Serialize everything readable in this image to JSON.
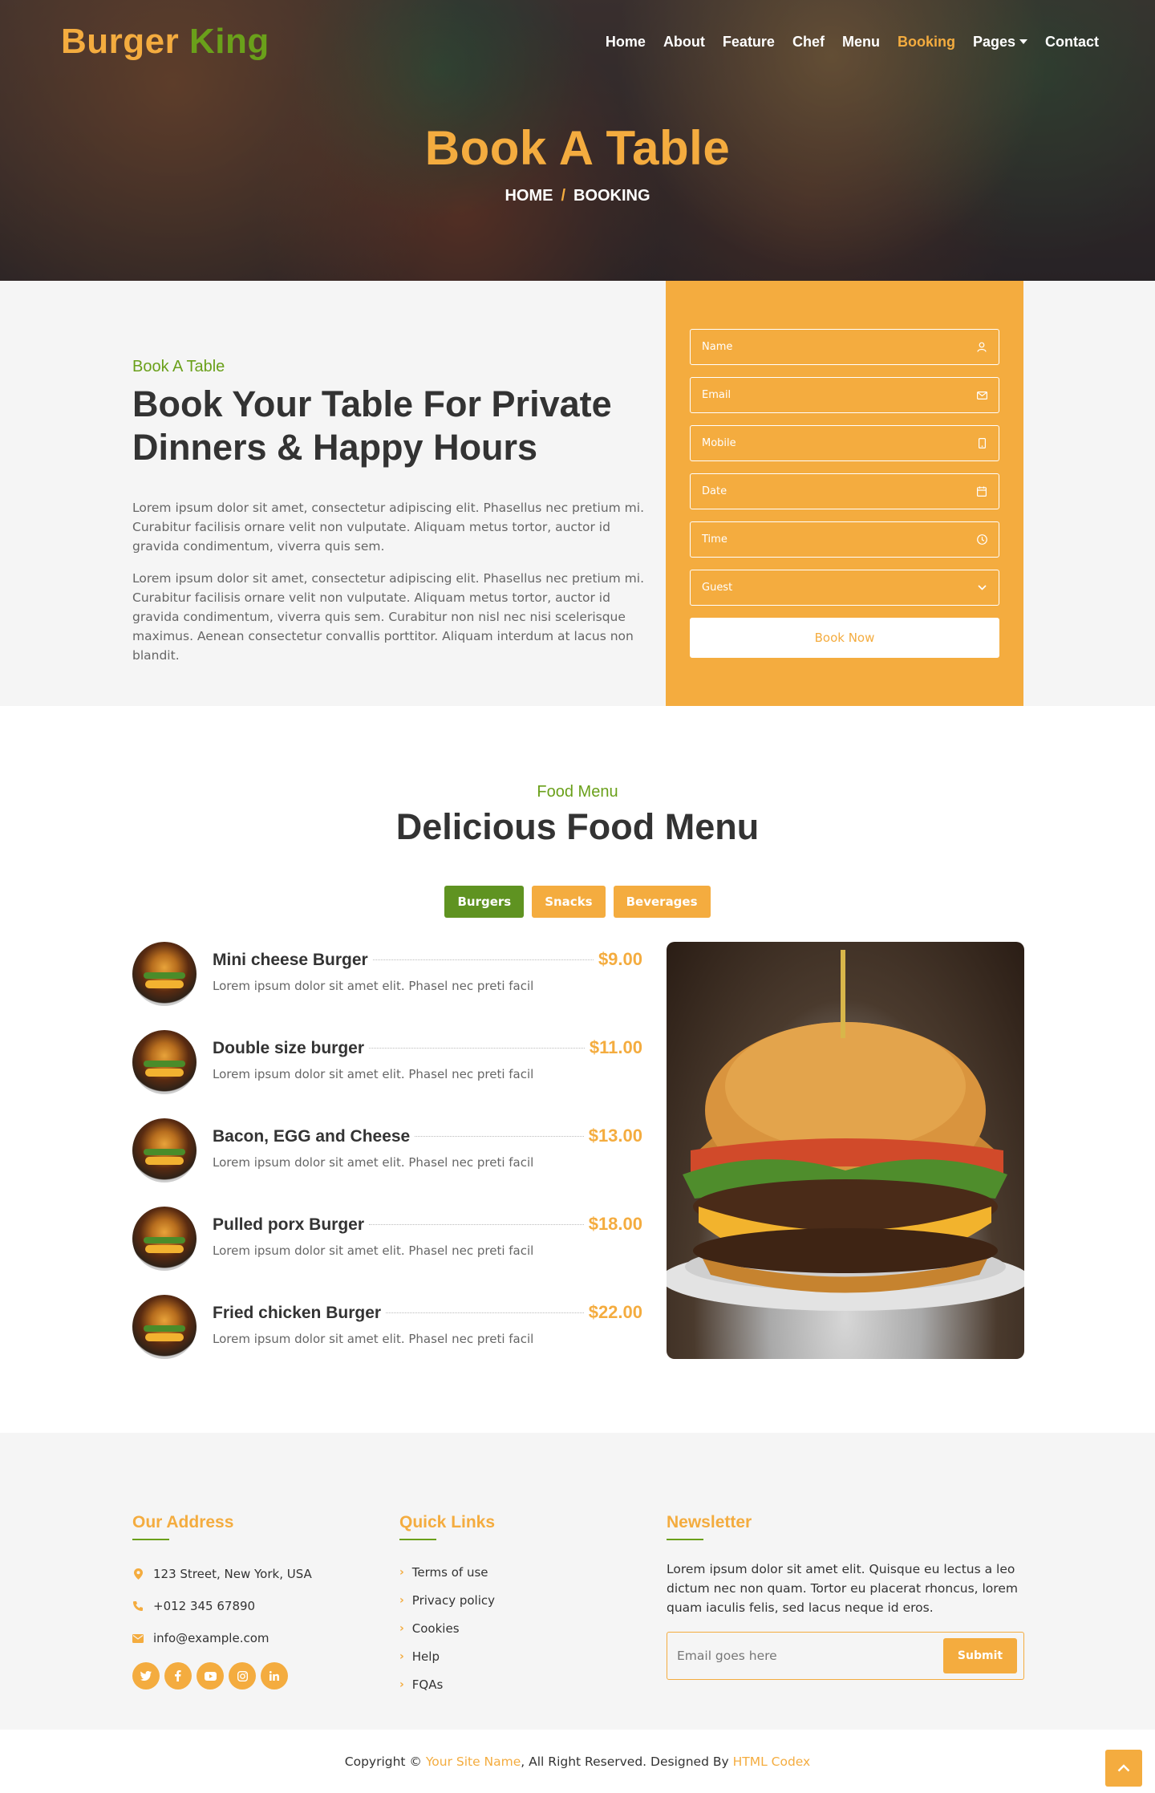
{
  "brand": {
    "part1": "Burger",
    "part2": "King"
  },
  "nav": {
    "items": [
      "Home",
      "About",
      "Feature",
      "Chef",
      "Menu",
      "Booking",
      "Pages",
      "Contact"
    ],
    "active": "Booking"
  },
  "hero": {
    "title": "Book A Table",
    "breadcrumb_home": "HOME",
    "breadcrumb_sep": "/",
    "breadcrumb_current": "BOOKING"
  },
  "booking": {
    "eyebrow": "Book A Table",
    "heading_line1": "Book Your Table For Private",
    "heading_line2": "Dinners & Happy Hours",
    "para1": "Lorem ipsum dolor sit amet, consectetur adipiscing elit. Phasellus nec pretium mi. Curabitur facilisis ornare velit non vulputate. Aliquam metus tortor, auctor id gravida condimentum, viverra quis sem.",
    "para2": "Lorem ipsum dolor sit amet, consectetur adipiscing elit. Phasellus nec pretium mi. Curabitur facilisis ornare velit non vulputate. Aliquam metus tortor, auctor id gravida condimentum, viverra quis sem. Curabitur non nisl nec nisi scelerisque maximus. Aenean consectetur convallis porttitor. Aliquam interdum at lacus non blandit.",
    "form": {
      "name_placeholder": "Name",
      "email_placeholder": "Email",
      "mobile_placeholder": "Mobile",
      "date_placeholder": "Date",
      "time_placeholder": "Time",
      "guest_selected": "Guest",
      "submit_label": "Book Now"
    }
  },
  "menu": {
    "eyebrow": "Food Menu",
    "heading": "Delicious Food Menu",
    "tabs": [
      "Burgers",
      "Snacks",
      "Beverages"
    ],
    "active_tab": "Burgers",
    "items": [
      {
        "name": "Mini cheese Burger",
        "price": "$9.00",
        "desc": "Lorem ipsum dolor sit amet elit. Phasel nec preti facil"
      },
      {
        "name": "Double size burger",
        "price": "$11.00",
        "desc": "Lorem ipsum dolor sit amet elit. Phasel nec preti facil"
      },
      {
        "name": "Bacon, EGG and Cheese",
        "price": "$13.00",
        "desc": "Lorem ipsum dolor sit amet elit. Phasel nec preti facil"
      },
      {
        "name": "Pulled porx Burger",
        "price": "$18.00",
        "desc": "Lorem ipsum dolor sit amet elit. Phasel nec preti facil"
      },
      {
        "name": "Fried chicken Burger",
        "price": "$22.00",
        "desc": "Lorem ipsum dolor sit amet elit. Phasel nec preti facil"
      }
    ]
  },
  "footer": {
    "address": {
      "title": "Our Address",
      "street": "123 Street, New York, USA",
      "phone": "+012 345 67890",
      "email": "info@example.com",
      "socials": [
        "twitter-icon",
        "facebook-icon",
        "youtube-icon",
        "instagram-icon",
        "linkedin-icon"
      ]
    },
    "links": {
      "title": "Quick Links",
      "items": [
        "Terms of use",
        "Privacy policy",
        "Cookies",
        "Help",
        "FQAs"
      ]
    },
    "newsletter": {
      "title": "Newsletter",
      "text": "Lorem ipsum dolor sit amet elit. Quisque eu lectus a leo dictum nec non quam. Tortor eu placerat rhoncus, lorem quam iaculis felis, sed lacus neque id eros.",
      "placeholder": "Email goes here",
      "submit_label": "Submit"
    }
  },
  "copyright": {
    "prefix": "Copyright © ",
    "site_name": "Your Site Name",
    "middle": ", All Right Reserved. Designed By ",
    "designer": "HTML Codex"
  },
  "colors": {
    "accent": "#f4ac3f",
    "green": "#6aa01a",
    "tab_active": "#5f9321"
  }
}
